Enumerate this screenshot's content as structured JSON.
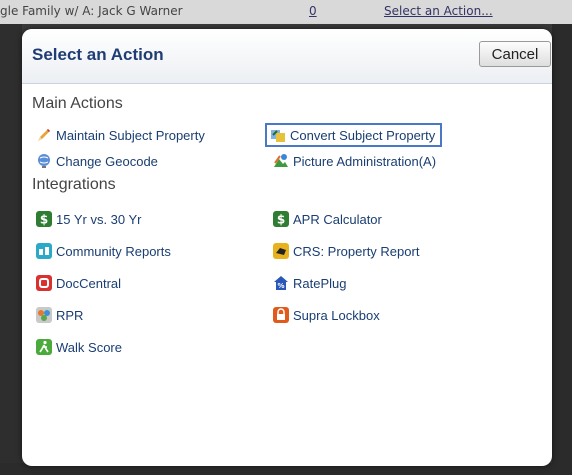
{
  "background": {
    "row_text": "gle Family w/ A: Jack G Warner",
    "row_count": "0",
    "row_link": "Select an Action..."
  },
  "dialog": {
    "title": "Select an Action",
    "cancel_label": "Cancel",
    "main_actions": {
      "heading": "Main Actions",
      "items": [
        {
          "label": "Maintain Subject Property",
          "icon": "pencil-icon"
        },
        {
          "label": "Convert Subject Property",
          "icon": "convert-icon"
        },
        {
          "label": "Change Geocode",
          "icon": "globe-icon"
        },
        {
          "label": "Picture Administration(A)",
          "icon": "picture-icon"
        }
      ]
    },
    "integrations": {
      "heading": "Integrations",
      "items": [
        {
          "label": "15 Yr vs. 30 Yr",
          "icon": "dollar-icon"
        },
        {
          "label": "APR Calculator",
          "icon": "dollar-icon"
        },
        {
          "label": "Community Reports",
          "icon": "community-icon"
        },
        {
          "label": "CRS: Property Report",
          "icon": "crs-icon"
        },
        {
          "label": "DocCentral",
          "icon": "doccentral-icon"
        },
        {
          "label": "RatePlug",
          "icon": "rateplug-icon"
        },
        {
          "label": "RPR",
          "icon": "rpr-icon"
        },
        {
          "label": "Supra Lockbox",
          "icon": "lockbox-icon"
        },
        {
          "label": "Walk Score",
          "icon": "walk-icon"
        }
      ]
    }
  }
}
